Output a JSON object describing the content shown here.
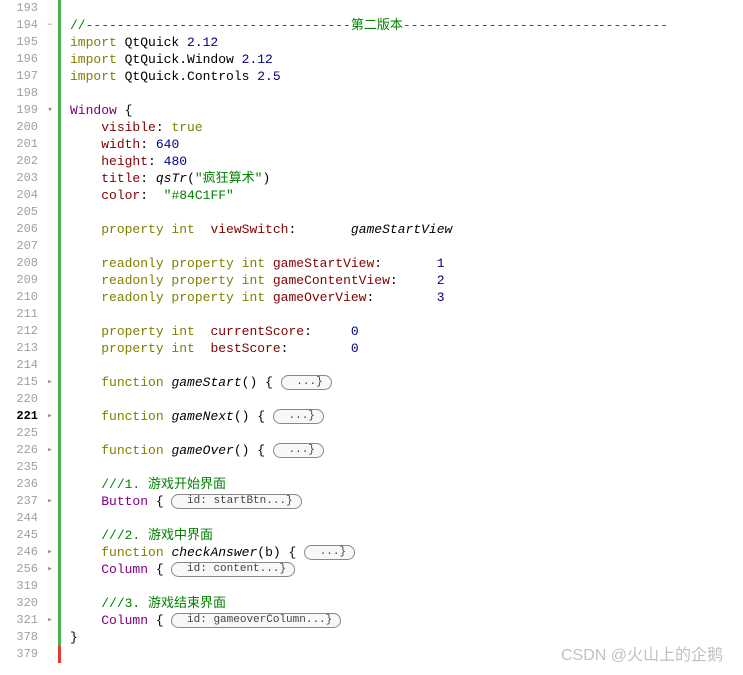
{
  "watermark": "CSDN @火山上的企鹅",
  "fold_minus": "−",
  "fold_plus": "▸",
  "lines": [
    {
      "num": "193",
      "bar": "green",
      "code": []
    },
    {
      "num": "194",
      "bar": "green",
      "fold": "−",
      "code": [
        {
          "t": "c-comment",
          "v": "//----------------------------------第二版本----------------------------------"
        }
      ]
    },
    {
      "num": "195",
      "bar": "green",
      "code": [
        {
          "t": "c-keyword",
          "v": "import "
        },
        {
          "t": "",
          "v": "QtQuick "
        },
        {
          "t": "c-num",
          "v": "2.12"
        }
      ]
    },
    {
      "num": "196",
      "bar": "green",
      "code": [
        {
          "t": "c-keyword",
          "v": "import "
        },
        {
          "t": "",
          "v": "QtQuick"
        },
        {
          "t": "",
          "v": ".Window "
        },
        {
          "t": "c-num",
          "v": "2.12"
        }
      ]
    },
    {
      "num": "197",
      "bar": "green",
      "code": [
        {
          "t": "c-keyword",
          "v": "import "
        },
        {
          "t": "",
          "v": "QtQuick"
        },
        {
          "t": "",
          "v": ".Controls "
        },
        {
          "t": "c-num",
          "v": "2.5"
        }
      ]
    },
    {
      "num": "198",
      "bar": "green",
      "code": []
    },
    {
      "num": "199",
      "bar": "green",
      "fold": "▾",
      "code": [
        {
          "t": "c-type",
          "v": "Window"
        },
        {
          "t": "",
          "v": " {"
        }
      ]
    },
    {
      "num": "200",
      "bar": "green",
      "code": [
        {
          "t": "",
          "v": "    "
        },
        {
          "t": "c-prop",
          "v": "visible"
        },
        {
          "t": "",
          "v": ": "
        },
        {
          "t": "c-bool",
          "v": "true"
        }
      ]
    },
    {
      "num": "201",
      "bar": "green",
      "code": [
        {
          "t": "",
          "v": "    "
        },
        {
          "t": "c-prop",
          "v": "width"
        },
        {
          "t": "",
          "v": ": "
        },
        {
          "t": "c-num",
          "v": "640"
        }
      ]
    },
    {
      "num": "202",
      "bar": "green",
      "code": [
        {
          "t": "",
          "v": "    "
        },
        {
          "t": "c-prop",
          "v": "height"
        },
        {
          "t": "",
          "v": ": "
        },
        {
          "t": "c-num",
          "v": "480"
        }
      ]
    },
    {
      "num": "203",
      "bar": "green",
      "code": [
        {
          "t": "",
          "v": "    "
        },
        {
          "t": "c-prop",
          "v": "title"
        },
        {
          "t": "",
          "v": ": "
        },
        {
          "t": "c-funccall",
          "v": "qsTr"
        },
        {
          "t": "",
          "v": "("
        },
        {
          "t": "c-string",
          "v": "\"疯狂算术\""
        },
        {
          "t": "",
          "v": ")"
        }
      ]
    },
    {
      "num": "204",
      "bar": "green",
      "code": [
        {
          "t": "",
          "v": "    "
        },
        {
          "t": "c-prop",
          "v": "color"
        },
        {
          "t": "",
          "v": ":  "
        },
        {
          "t": "c-string",
          "v": "\"#84C1FF\""
        }
      ]
    },
    {
      "num": "205",
      "bar": "green",
      "code": []
    },
    {
      "num": "206",
      "bar": "green",
      "code": [
        {
          "t": "",
          "v": "    "
        },
        {
          "t": "c-keyword",
          "v": "property int"
        },
        {
          "t": "",
          "v": "  "
        },
        {
          "t": "c-prop",
          "v": "viewSwitch"
        },
        {
          "t": "",
          "v": ":       "
        },
        {
          "t": "c-id",
          "v": "gameStartView"
        }
      ]
    },
    {
      "num": "207",
      "bar": "green",
      "code": []
    },
    {
      "num": "208",
      "bar": "green",
      "code": [
        {
          "t": "",
          "v": "    "
        },
        {
          "t": "c-keyword",
          "v": "readonly property int"
        },
        {
          "t": "",
          "v": " "
        },
        {
          "t": "c-prop",
          "v": "gameStartView"
        },
        {
          "t": "",
          "v": ":       "
        },
        {
          "t": "c-num",
          "v": "1"
        }
      ]
    },
    {
      "num": "209",
      "bar": "green",
      "code": [
        {
          "t": "",
          "v": "    "
        },
        {
          "t": "c-keyword",
          "v": "readonly property int"
        },
        {
          "t": "",
          "v": " "
        },
        {
          "t": "c-prop",
          "v": "gameContentView"
        },
        {
          "t": "",
          "v": ":     "
        },
        {
          "t": "c-num",
          "v": "2"
        }
      ]
    },
    {
      "num": "210",
      "bar": "green",
      "code": [
        {
          "t": "",
          "v": "    "
        },
        {
          "t": "c-keyword",
          "v": "readonly property int"
        },
        {
          "t": "",
          "v": " "
        },
        {
          "t": "c-prop",
          "v": "gameOverView"
        },
        {
          "t": "",
          "v": ":        "
        },
        {
          "t": "c-num",
          "v": "3"
        }
      ]
    },
    {
      "num": "211",
      "bar": "green",
      "code": []
    },
    {
      "num": "212",
      "bar": "green",
      "code": [
        {
          "t": "",
          "v": "    "
        },
        {
          "t": "c-keyword",
          "v": "property int"
        },
        {
          "t": "",
          "v": "  "
        },
        {
          "t": "c-prop",
          "v": "currentScore"
        },
        {
          "t": "",
          "v": ":     "
        },
        {
          "t": "c-num",
          "v": "0"
        }
      ]
    },
    {
      "num": "213",
      "bar": "green",
      "code": [
        {
          "t": "",
          "v": "    "
        },
        {
          "t": "c-keyword",
          "v": "property int"
        },
        {
          "t": "",
          "v": "  "
        },
        {
          "t": "c-prop",
          "v": "bestScore"
        },
        {
          "t": "",
          "v": ":        "
        },
        {
          "t": "c-num",
          "v": "0"
        }
      ]
    },
    {
      "num": "214",
      "bar": "green",
      "code": []
    },
    {
      "num": "215",
      "bar": "green",
      "fold": "▸",
      "code": [
        {
          "t": "",
          "v": "    "
        },
        {
          "t": "c-keyword",
          "v": "function"
        },
        {
          "t": "",
          "v": " "
        },
        {
          "t": "c-func",
          "v": "gameStart"
        },
        {
          "t": "",
          "v": "() { "
        },
        {
          "t": "fold",
          "v": " ...}"
        }
      ]
    },
    {
      "num": "220",
      "bar": "green",
      "code": []
    },
    {
      "num": "221",
      "bar": "green",
      "hl": true,
      "fold": "▸",
      "code": [
        {
          "t": "",
          "v": "    "
        },
        {
          "t": "c-keyword",
          "v": "function"
        },
        {
          "t": "",
          "v": " "
        },
        {
          "t": "c-func",
          "v": "gameNext"
        },
        {
          "t": "",
          "v": "() { "
        },
        {
          "t": "fold",
          "v": " ...}"
        }
      ]
    },
    {
      "num": "225",
      "bar": "green",
      "code": []
    },
    {
      "num": "226",
      "bar": "green",
      "fold": "▸",
      "code": [
        {
          "t": "",
          "v": "    "
        },
        {
          "t": "c-keyword",
          "v": "function"
        },
        {
          "t": "",
          "v": " "
        },
        {
          "t": "c-func",
          "v": "gameOver"
        },
        {
          "t": "",
          "v": "() { "
        },
        {
          "t": "fold",
          "v": " ...}"
        }
      ]
    },
    {
      "num": "235",
      "bar": "green",
      "code": []
    },
    {
      "num": "236",
      "bar": "green",
      "code": [
        {
          "t": "",
          "v": "    "
        },
        {
          "t": "c-comment",
          "v": "///1. 游戏开始界面"
        }
      ]
    },
    {
      "num": "237",
      "bar": "green",
      "fold": "▸",
      "code": [
        {
          "t": "",
          "v": "    "
        },
        {
          "t": "c-type",
          "v": "Button"
        },
        {
          "t": "",
          "v": " { "
        },
        {
          "t": "fold",
          "v": " id: startBtn...}"
        }
      ]
    },
    {
      "num": "244",
      "bar": "green",
      "code": []
    },
    {
      "num": "245",
      "bar": "green",
      "code": [
        {
          "t": "",
          "v": "    "
        },
        {
          "t": "c-comment",
          "v": "///2. 游戏中界面"
        }
      ]
    },
    {
      "num": "246",
      "bar": "green",
      "fold": "▸",
      "code": [
        {
          "t": "",
          "v": "    "
        },
        {
          "t": "c-keyword",
          "v": "function"
        },
        {
          "t": "",
          "v": " "
        },
        {
          "t": "c-func",
          "v": "checkAnswer"
        },
        {
          "t": "",
          "v": "(b) { "
        },
        {
          "t": "fold",
          "v": " ...}"
        }
      ]
    },
    {
      "num": "256",
      "bar": "green",
      "fold": "▸",
      "code": [
        {
          "t": "",
          "v": "    "
        },
        {
          "t": "c-type",
          "v": "Column"
        },
        {
          "t": "",
          "v": " { "
        },
        {
          "t": "fold",
          "v": " id: content...}"
        }
      ]
    },
    {
      "num": "319",
      "bar": "green",
      "code": []
    },
    {
      "num": "320",
      "bar": "green",
      "code": [
        {
          "t": "",
          "v": "    "
        },
        {
          "t": "c-comment",
          "v": "///3. 游戏结束界面"
        }
      ]
    },
    {
      "num": "321",
      "bar": "green",
      "fold": "▸",
      "code": [
        {
          "t": "",
          "v": "    "
        },
        {
          "t": "c-type",
          "v": "Column"
        },
        {
          "t": "",
          "v": " { "
        },
        {
          "t": "fold",
          "v": " id: gameoverColumn...}"
        }
      ]
    },
    {
      "num": "378",
      "bar": "green",
      "code": [
        {
          "t": "",
          "v": "}"
        }
      ]
    },
    {
      "num": "379",
      "bar": "red",
      "code": []
    }
  ]
}
